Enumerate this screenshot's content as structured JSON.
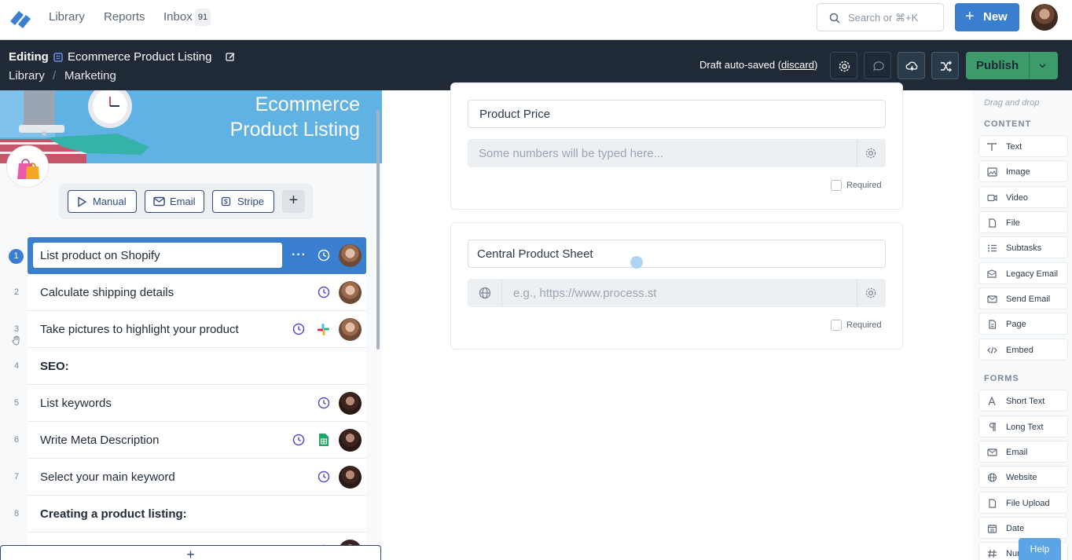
{
  "topnav": {
    "links": [
      "Library",
      "Reports",
      "Inbox"
    ],
    "inbox_count": "91",
    "search_placeholder": "Search or ⌘+K",
    "new_label": "New"
  },
  "editbar": {
    "mode": "Editing",
    "title": "Ecommerce Product Listing",
    "breadcrumb": [
      "Library",
      "Marketing"
    ],
    "draft_text": "Draft auto-saved (",
    "discard": "discard",
    "draft_close": ")",
    "publish_label": "Publish"
  },
  "banner": {
    "line1": "Ecommerce",
    "line2": "Product Listing"
  },
  "triggers": [
    "Manual",
    "Email",
    "Stripe"
  ],
  "tasks": [
    {
      "num": "1",
      "name": "List product on Shopify",
      "active": true
    },
    {
      "num": "2",
      "name": "Calculate shipping details"
    },
    {
      "num": "3",
      "name": "Take pictures to highlight your product"
    },
    {
      "num": "4",
      "name": "SEO:",
      "heading": true
    },
    {
      "num": "5",
      "name": "List keywords"
    },
    {
      "num": "6",
      "name": "Write Meta Description"
    },
    {
      "num": "7",
      "name": "Select your main keyword"
    },
    {
      "num": "8",
      "name": "Creating a product listing:",
      "heading": true
    }
  ],
  "main": {
    "field1": {
      "label": "Product Price",
      "placeholder": "Some numbers will be typed here...",
      "required": "Required"
    },
    "field2": {
      "label": "Central Product Sheet",
      "placeholder": "e.g., https://www.process.st",
      "required": "Required"
    }
  },
  "sidebar": {
    "hint": "Drag and drop",
    "content_title": "CONTENT",
    "content_items": [
      "Text",
      "Image",
      "Video",
      "File",
      "Subtasks",
      "Legacy Email",
      "Send Email",
      "Page",
      "Embed"
    ],
    "forms_title": "FORMS",
    "form_items": [
      "Short Text",
      "Long Text",
      "Email",
      "Website",
      "File Upload",
      "Date",
      "Num"
    ],
    "help_label": "Help"
  },
  "colors": {
    "primary": "#3a7ed0",
    "dark_bar": "#1f2a36",
    "publish_green": "#3d9a6a",
    "trigger_navy": "#2f4a7a",
    "clock_purple": "#5a4bc8"
  }
}
